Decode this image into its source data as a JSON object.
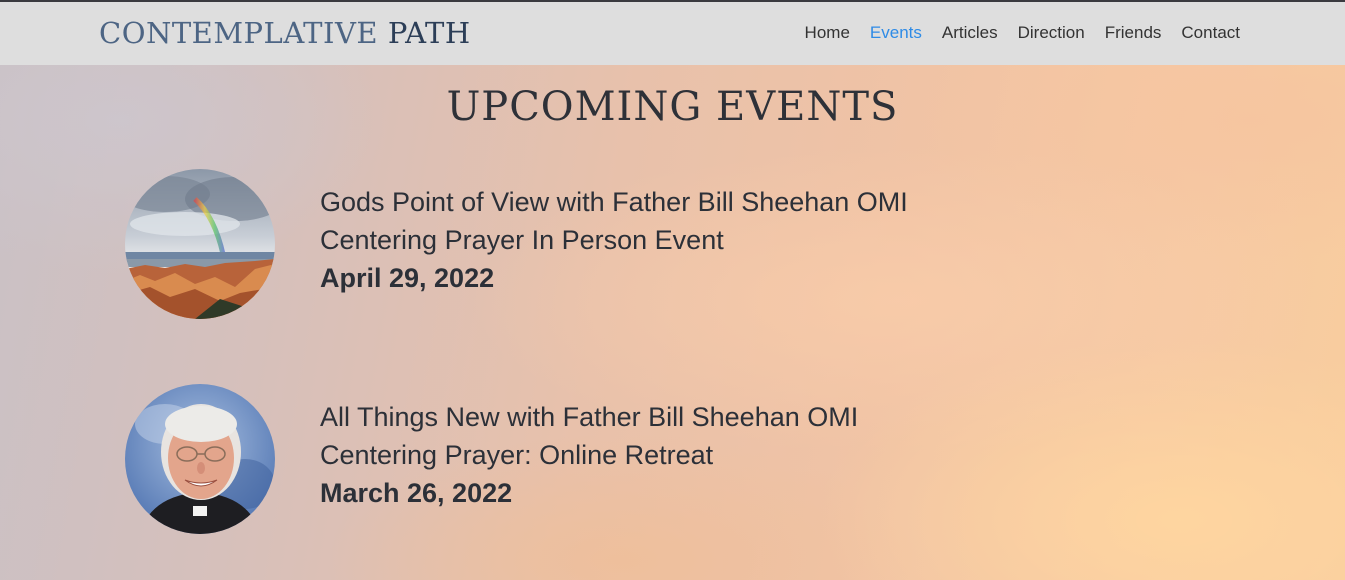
{
  "brand": {
    "part1": "CONTEMPLATIVE",
    "part2": "PATH"
  },
  "nav": {
    "items": [
      {
        "label": "Home",
        "active": false
      },
      {
        "label": "Events",
        "active": true
      },
      {
        "label": "Articles",
        "active": false
      },
      {
        "label": "Direction",
        "active": false
      },
      {
        "label": "Friends",
        "active": false
      },
      {
        "label": "Contact",
        "active": false
      }
    ],
    "active_color": "#2e8be6"
  },
  "page": {
    "title": "UPCOMING EVENTS"
  },
  "events": [
    {
      "title": "Gods Point of View with Father Bill Sheehan OMI",
      "subtitle": "Centering Prayer In Person Event",
      "date": "April 29, 2022",
      "image": "canyon-rainbow-landscape"
    },
    {
      "title": "All Things New with Father Bill Sheehan OMI",
      "subtitle": "Centering Prayer: Online Retreat",
      "date": "March 26, 2022",
      "image": "priest-portrait"
    }
  ]
}
